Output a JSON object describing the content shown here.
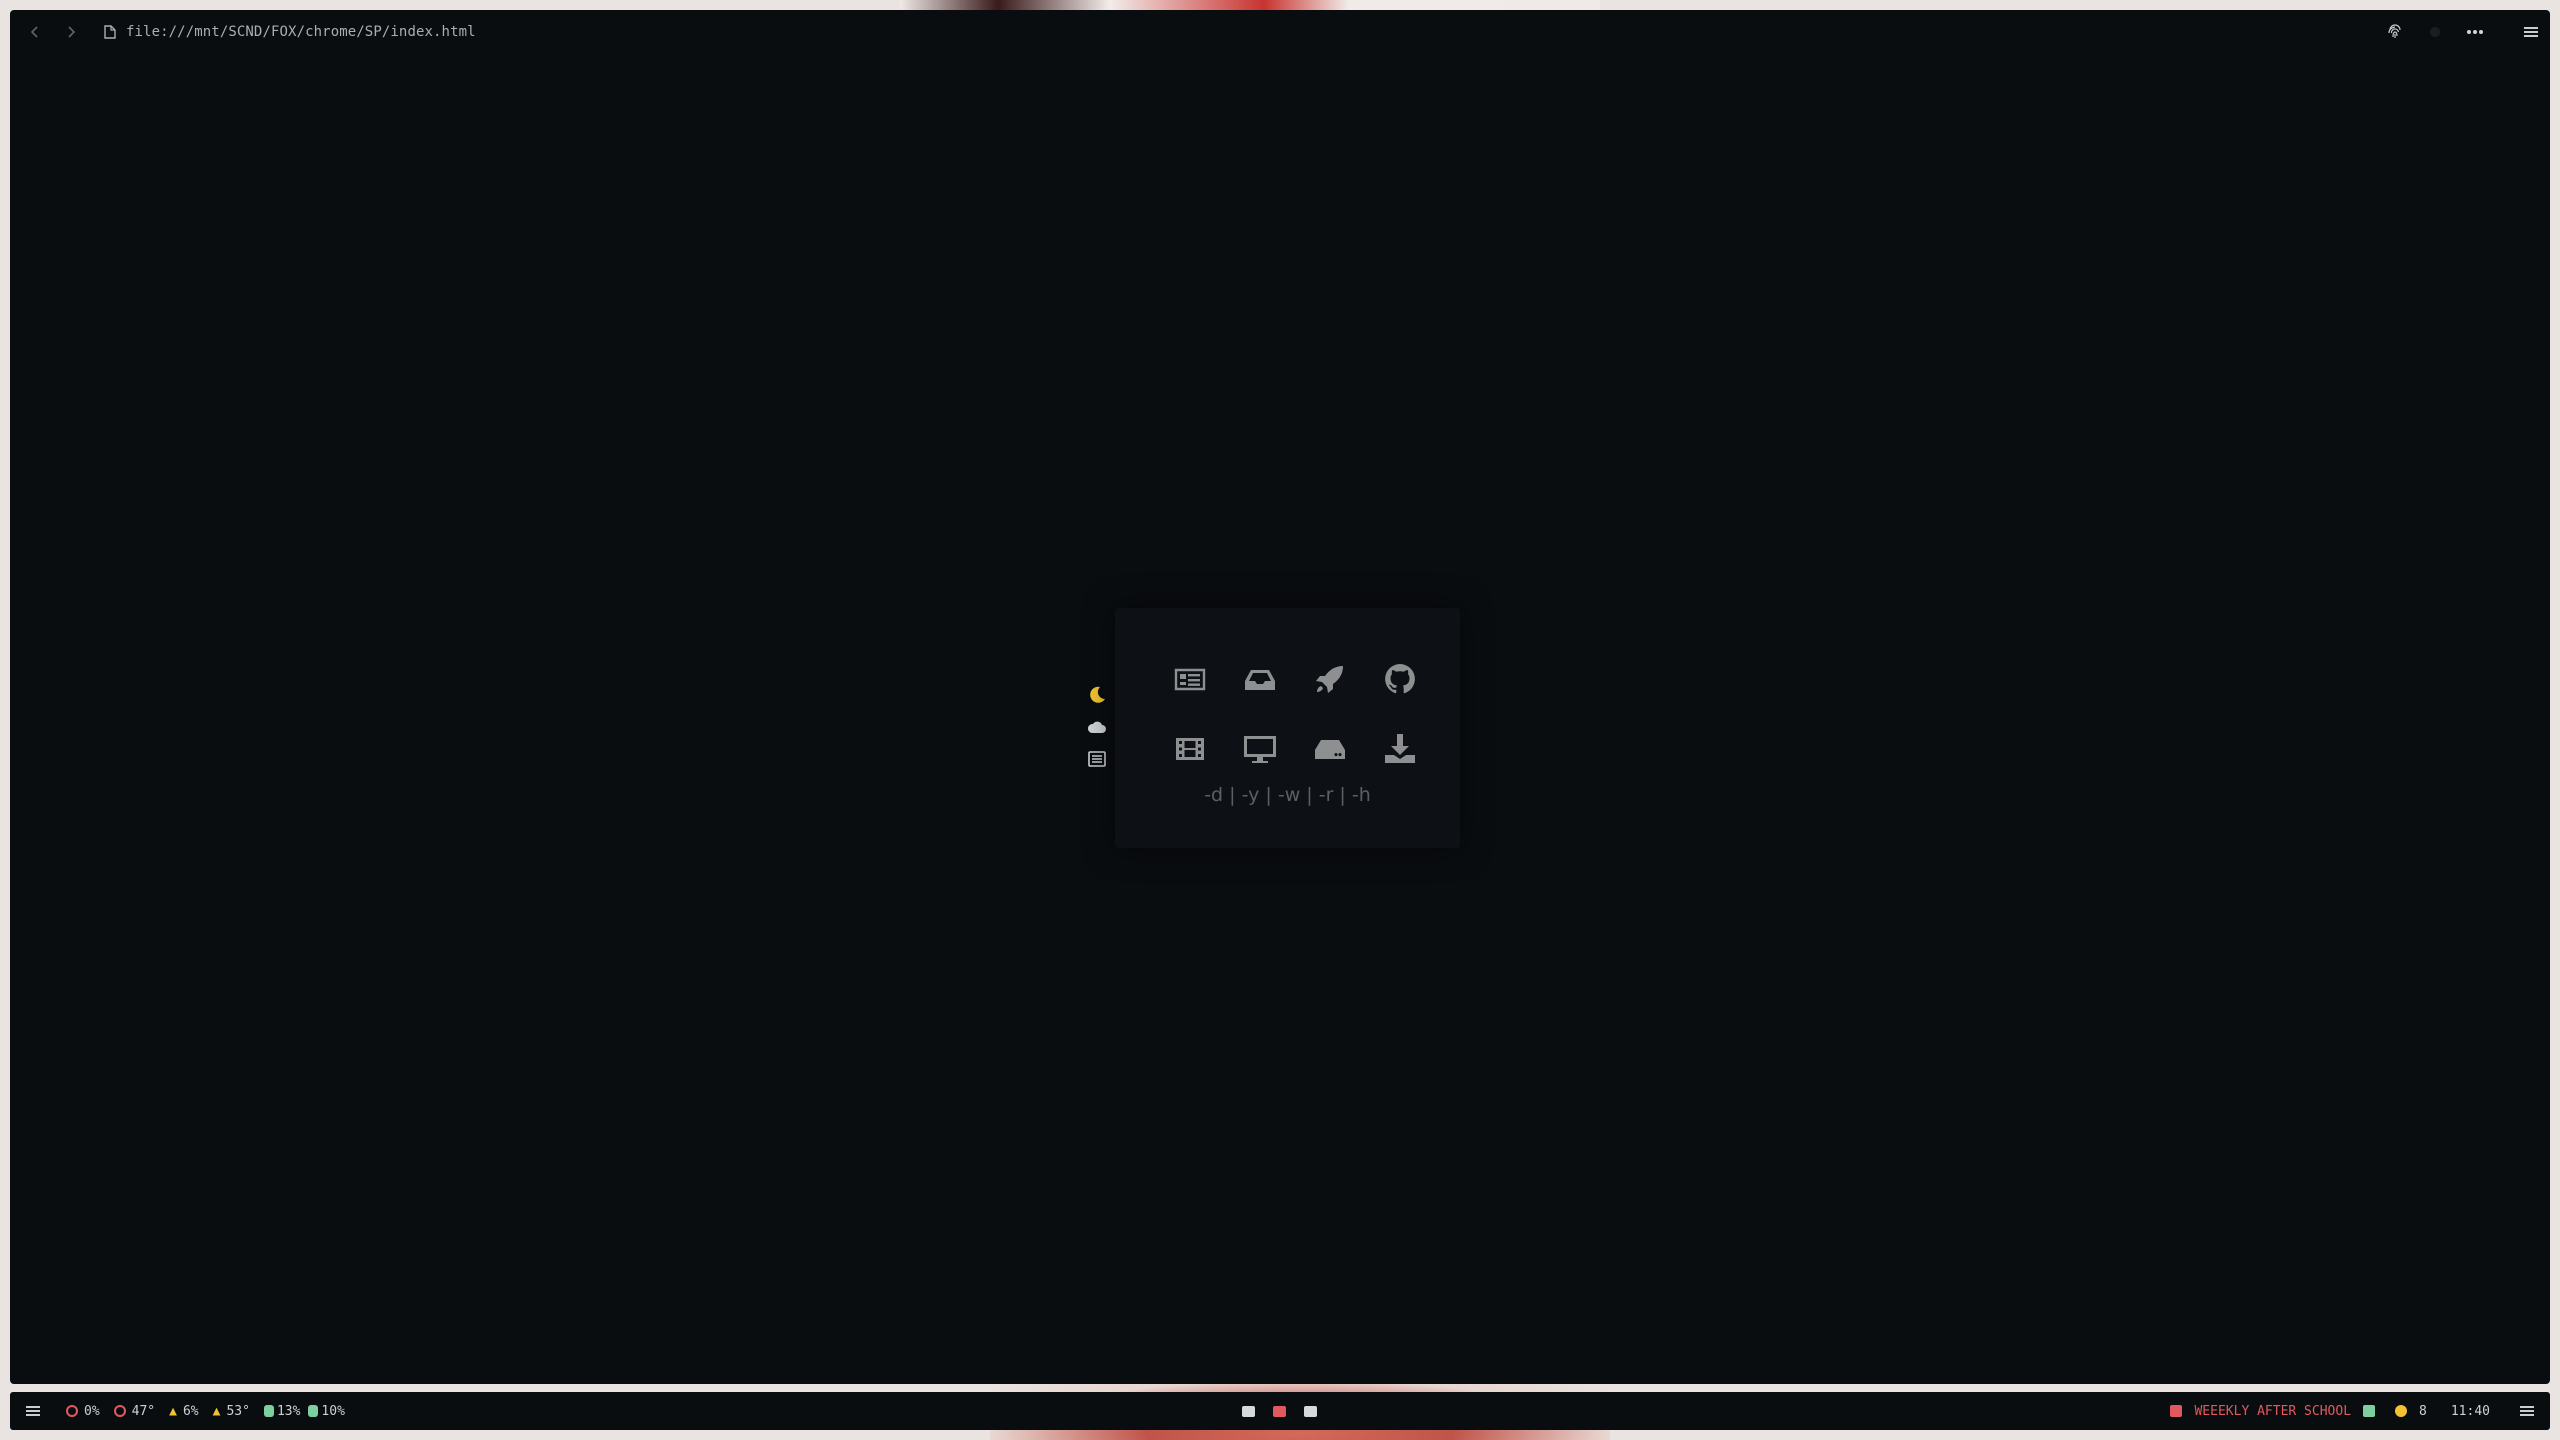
{
  "browser": {
    "url": "file:///mnt/SCND/FOX/chrome/SP/index.html"
  },
  "startpage": {
    "side_icons": [
      "moon-icon",
      "cloud-icon",
      "list-icon"
    ],
    "tiles": [
      {
        "icon": "newspaper-icon"
      },
      {
        "icon": "inbox-icon"
      },
      {
        "icon": "rocket-icon"
      },
      {
        "icon": "github-icon"
      },
      {
        "icon": "film-icon"
      },
      {
        "icon": "desktop-icon"
      },
      {
        "icon": "hdd-icon"
      },
      {
        "icon": "download-icon"
      }
    ],
    "command_hint": "-d | -y | -w | -r | -h"
  },
  "statusbar": {
    "cpu_usage": "0%",
    "cpu_temp": "47°",
    "gpu_usage": "6%",
    "gpu_temp": "53°",
    "disk1": "13%",
    "disk2": "10%",
    "now_playing": "WEEEKLY AFTER SCHOOL",
    "notifications": "8",
    "clock": "11:40"
  },
  "colors": {
    "background": "#0a0d10",
    "moon": "#f2c230",
    "red_accent": "#e2585f",
    "yellow_accent": "#f1c232",
    "green_accent": "#7ecfa0"
  }
}
